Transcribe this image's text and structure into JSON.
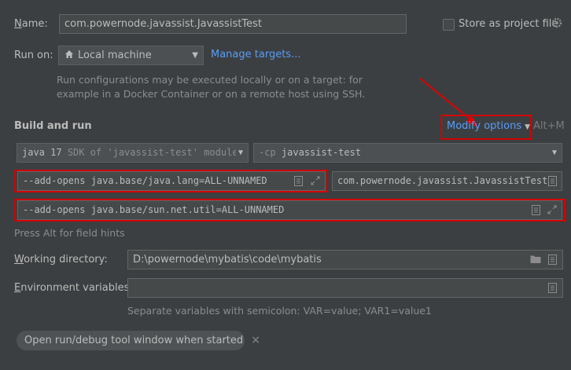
{
  "name": {
    "label": "Name:",
    "value": "com.powernode.javassist.JavassistTest"
  },
  "store_as_project_file": {
    "label": "Store as project file",
    "checked": false
  },
  "run_on": {
    "label": "Run on:",
    "selected": "Local machine",
    "manage_targets": "Manage targets...",
    "description_line1": "Run configurations may be executed locally or on a target: for",
    "description_line2": "example in a Docker Container or on a remote host using SSH."
  },
  "build_and_run": {
    "title": "Build and run",
    "modify_options": "Modify options",
    "shortcut": "Alt+M",
    "jdk": {
      "version": "java 17",
      "detail": "SDK of 'javassist-test' module"
    },
    "classpath": {
      "flag": "-cp",
      "module": "javassist-test"
    },
    "vm_options": "--add-opens java.base/java.lang=ALL-UNNAMED",
    "main_class": "com.powernode.javassist.JavassistTest",
    "program_arguments": "--add-opens java.base/sun.net.util=ALL-UNNAMED",
    "field_hint": "Press Alt for field hints"
  },
  "working_directory": {
    "label": "Working directory:",
    "value": "D:\\powernode\\mybatis\\code\\mybatis"
  },
  "environment_variables": {
    "label": "Environment variables:",
    "value": "",
    "hint": "Separate variables with semicolon: VAR=value; VAR1=value1"
  },
  "chips": {
    "open_tool_window": "Open run/debug tool window when started",
    "close_glyph": "×"
  },
  "colors": {
    "background": "#3c3f41",
    "link": "#589df6",
    "highlight": "#d40000"
  }
}
